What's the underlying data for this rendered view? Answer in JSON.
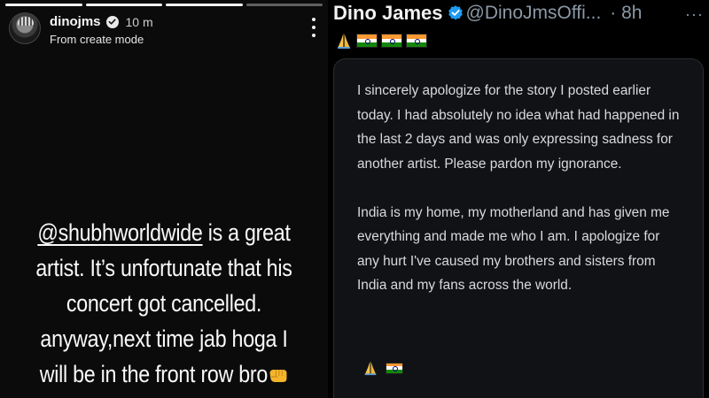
{
  "story": {
    "username": "dinojms",
    "time": "10 m",
    "subtitle": "From create mode",
    "mention": "@shubhworldwide",
    "text_after_mention": " is a great artist. It’s unfortunate that his concert got cancelled. anyway,next time jab hoga I will be in the front row bro",
    "emoji_icon": "left-facing-fist-icon"
  },
  "tweet": {
    "name": "Dino James",
    "handle": "@DinoJmsOffi...",
    "time": "· 8h",
    "menu": "···",
    "header_emojis": [
      "folded-hands-icon",
      "india-flag-icon",
      "india-flag-icon",
      "india-flag-icon"
    ],
    "card": {
      "paragraph1": "I sincerely apologize for the story I posted earlier today. I had absolutely no idea what had happened in the last 2 days and was only expressing sadness for another artist. Please pardon my ignorance.",
      "paragraph2": "India is my home, my motherland and has given me everything and made me who I am. I apologize for any hurt I've caused my brothers and sisters from India and my fans across the world.",
      "footer_emojis": [
        "folded-hands-icon",
        "india-flag-icon"
      ]
    }
  },
  "colors": {
    "verified_blue": "#1d9bf0",
    "handle_gray": "#8b98a5",
    "card_bg": "#101215",
    "saffron": "#ff9933",
    "india_green": "#138808"
  }
}
